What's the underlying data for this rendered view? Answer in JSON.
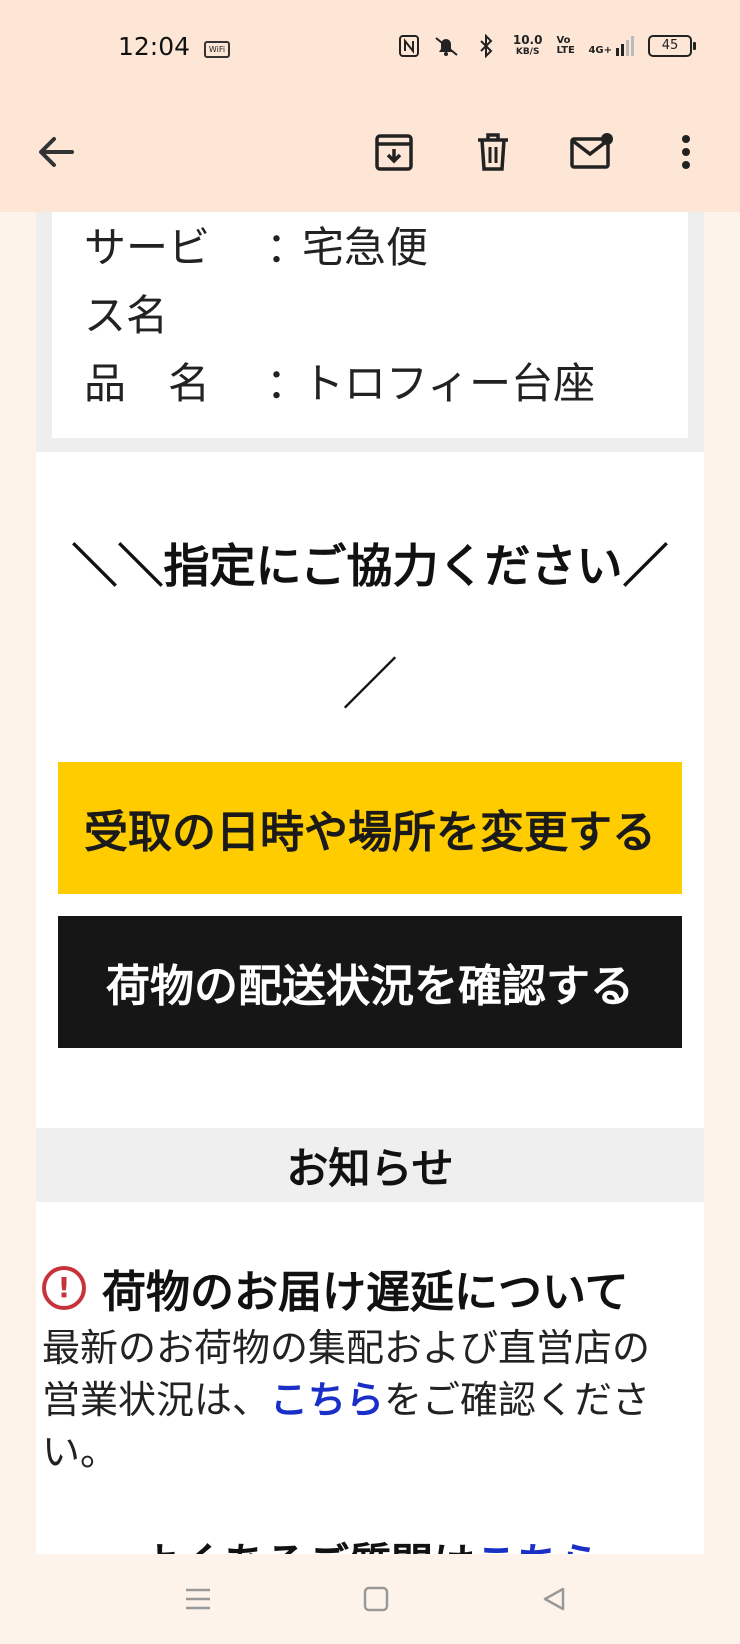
{
  "status_bar": {
    "time": "12:04",
    "wifi_label": "WiFi",
    "net_speed_value": "10.0",
    "net_speed_unit": "KB/S",
    "volte_label": "Vo LTE",
    "network_label": "4G+",
    "battery_level": "45"
  },
  "toolbar": {
    "icons": [
      "back-arrow-icon",
      "archive-icon",
      "delete-icon",
      "mark-unread-icon",
      "more-vert-icon"
    ]
  },
  "info": {
    "service_label_1": "サービ",
    "service_label_2": "ス名",
    "service_colon": "：",
    "service_value": "宅急便",
    "item_label": "品　名",
    "item_colon": "：",
    "item_value": "トロフィー台座"
  },
  "heading": {
    "line1": "＼＼指定にご協力ください／",
    "line2": "／"
  },
  "buttons": {
    "change_delivery": "受取の日時や場所を変更する",
    "check_status": "荷物の配送状況を確認する"
  },
  "notice": {
    "section_title": "お知らせ",
    "title": "荷物のお届け遅延について",
    "body_1": "最新のお荷物の集配および直営店の営業状況は、",
    "link": "こちら",
    "body_2": "をご確認ください。",
    "faq_text": "よくあるご質問は",
    "faq_link": "こちら"
  },
  "colors": {
    "header_bg": "#fde6d6",
    "accent_yellow": "#ffcc00",
    "button_black": "#161616",
    "link_blue": "#1a2ec8",
    "alert_red": "#c8323a"
  }
}
